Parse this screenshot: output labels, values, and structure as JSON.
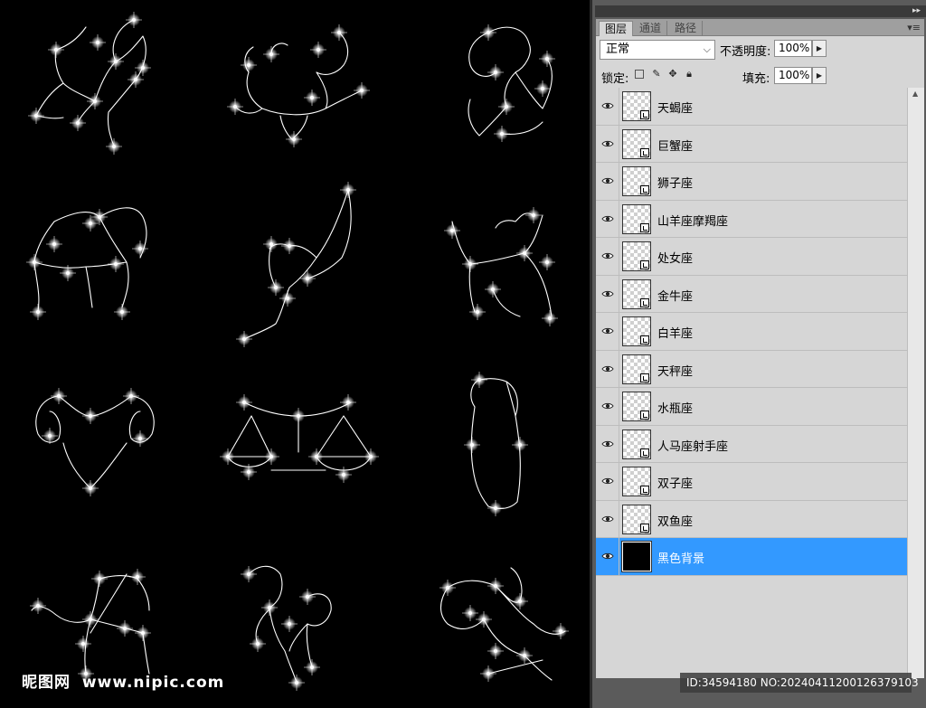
{
  "panel": {
    "tabs": [
      {
        "label": "图层",
        "active": true
      },
      {
        "label": "通道",
        "active": false
      },
      {
        "label": "路径",
        "active": false
      }
    ],
    "blend_mode": "正常",
    "opacity_label": "不透明度:",
    "opacity_value": "100%",
    "lock_label": "锁定:",
    "fill_label": "填充:",
    "fill_value": "100%",
    "layers": [
      {
        "name": "天蝎座",
        "selected": false
      },
      {
        "name": "巨蟹座",
        "selected": false
      },
      {
        "name": "狮子座",
        "selected": false
      },
      {
        "name": "山羊座摩羯座",
        "selected": false
      },
      {
        "name": "处女座",
        "selected": false
      },
      {
        "name": "金牛座",
        "selected": false
      },
      {
        "name": "白羊座",
        "selected": false
      },
      {
        "name": "天秤座",
        "selected": false
      },
      {
        "name": "水瓶座",
        "selected": false
      },
      {
        "name": "人马座射手座",
        "selected": false
      },
      {
        "name": "双子座",
        "selected": false
      },
      {
        "name": "双鱼座",
        "selected": false
      },
      {
        "name": "黑色背景",
        "selected": true
      }
    ]
  },
  "watermark": {
    "logo": "昵图网",
    "site": "www.nipic.com",
    "id_text": "ID:34594180 NO:20240411200126379103"
  },
  "colors": {
    "selection": "#3399ff",
    "panel_bg": "#d6d6d6",
    "canvas_bg": "#000000"
  }
}
